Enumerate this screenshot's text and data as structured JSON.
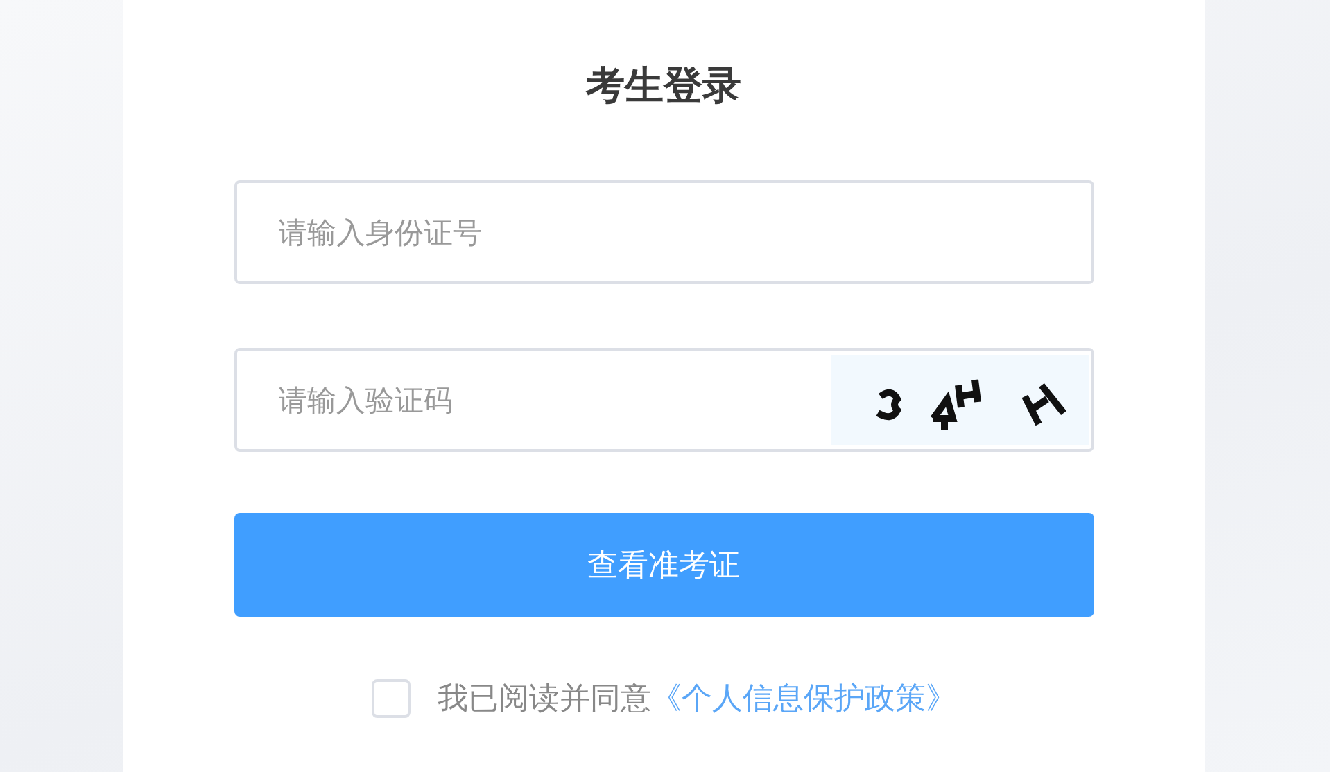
{
  "title": "考生登录",
  "fields": [
    {
      "placeholder": "请输入身份证号",
      "kind": "text"
    },
    {
      "placeholder": "请输入验证码",
      "kind": "captcha"
    }
  ],
  "submit_button": "查看准考证",
  "agreement": {
    "checked": false,
    "text": "我已阅读并同意",
    "link": "《个人信息保护政策》"
  }
}
